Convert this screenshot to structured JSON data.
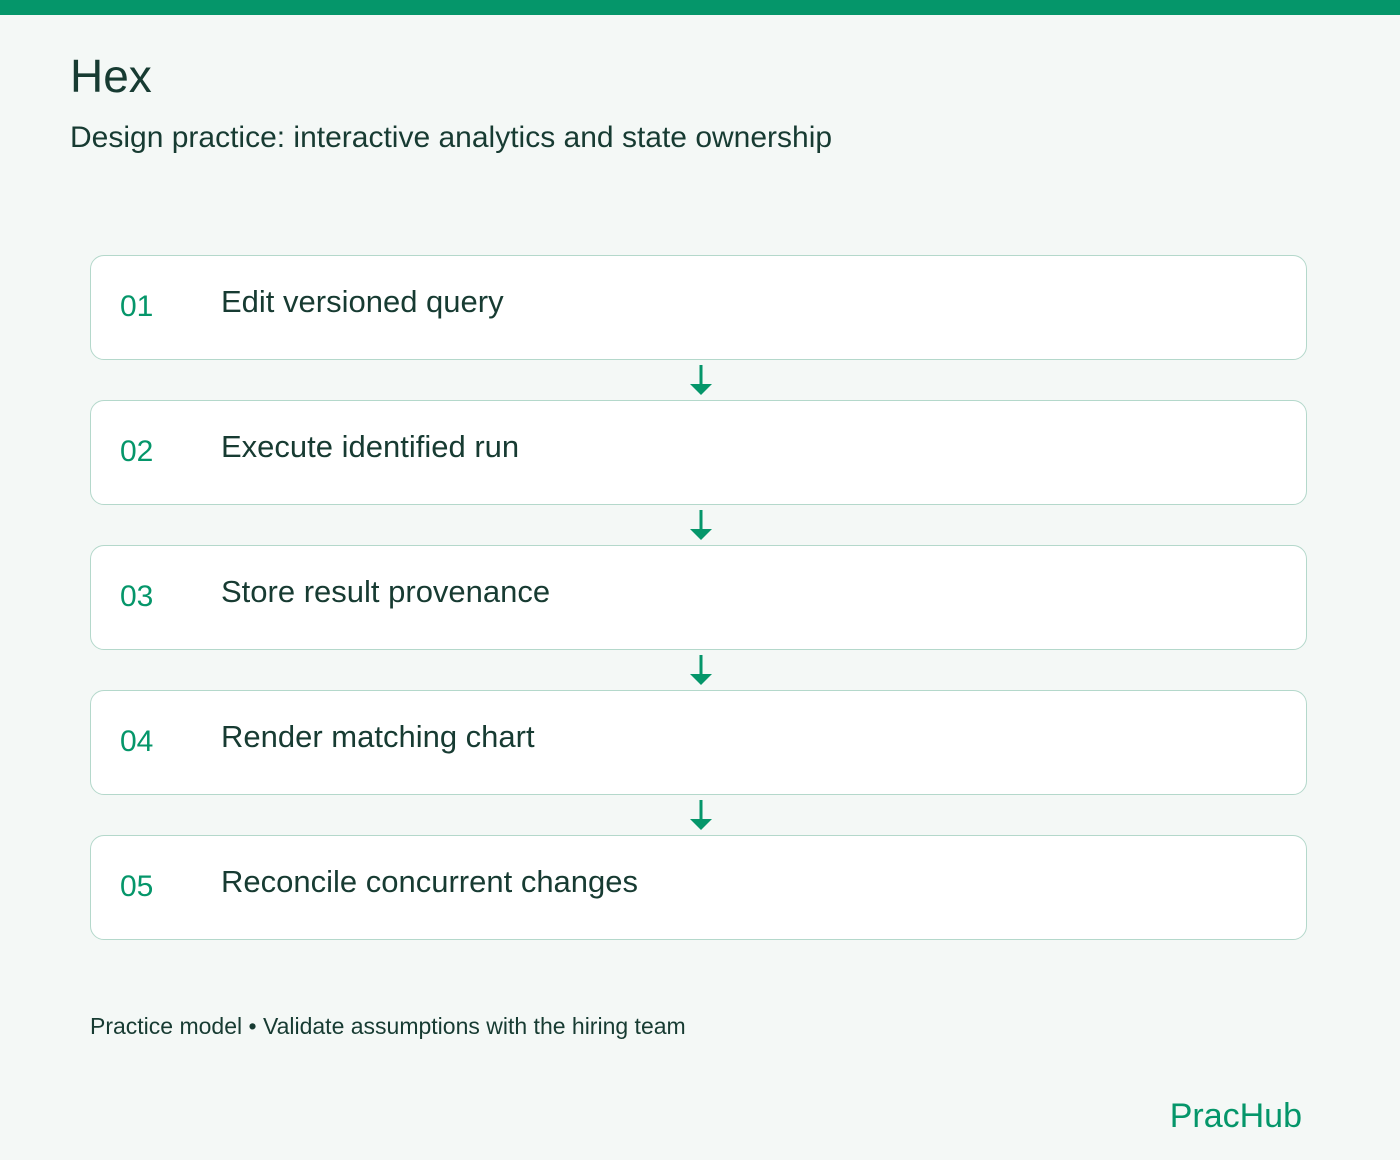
{
  "header": {
    "title": "Hex",
    "subtitle": "Design practice: interactive analytics and state ownership"
  },
  "steps": [
    {
      "number": "01",
      "label": "Edit versioned query"
    },
    {
      "number": "02",
      "label": "Execute identified run"
    },
    {
      "number": "03",
      "label": "Store result provenance"
    },
    {
      "number": "04",
      "label": "Render matching chart"
    },
    {
      "number": "05",
      "label": "Reconcile concurrent changes"
    }
  ],
  "footer": {
    "note": "Practice model • Validate assumptions with the hiring team",
    "brand": "PracHub"
  },
  "colors": {
    "accent": "#05966a",
    "text": "#173b32",
    "background": "#f4f8f6",
    "card_border": "#b4d8cb"
  },
  "icons": {
    "connector": "arrow-down-icon"
  }
}
